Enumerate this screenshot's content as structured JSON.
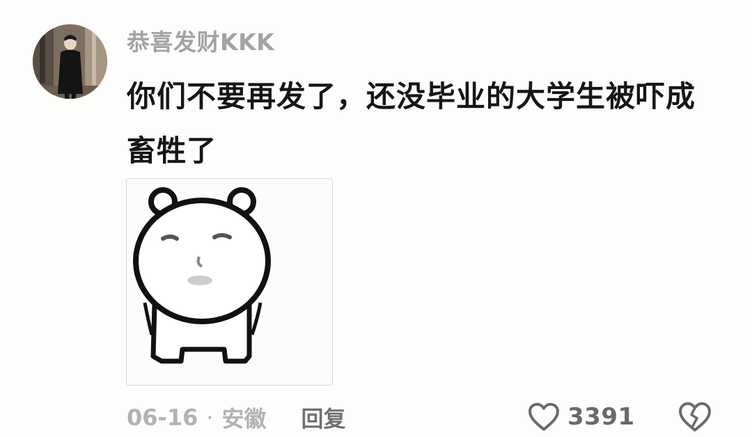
{
  "comment": {
    "username": "恭喜发财KKK",
    "text": "你们不要再发了，还没毕业的大学生被吓成畜牲了",
    "date": "06-16",
    "separator": "·",
    "location": "安徽",
    "reply_label": "回复",
    "like_count": "3391",
    "sticker": "white-bear-meme-sticker",
    "icons": {
      "like": "heart-outline-icon",
      "dislike": "broken-heart-icon"
    }
  },
  "colors": {
    "background": "#fdfdfc",
    "username": "#a3a3a3",
    "text": "#161616",
    "meta": "#b2b2b2",
    "reply": "#707070",
    "icon": "#6a6a6a"
  }
}
